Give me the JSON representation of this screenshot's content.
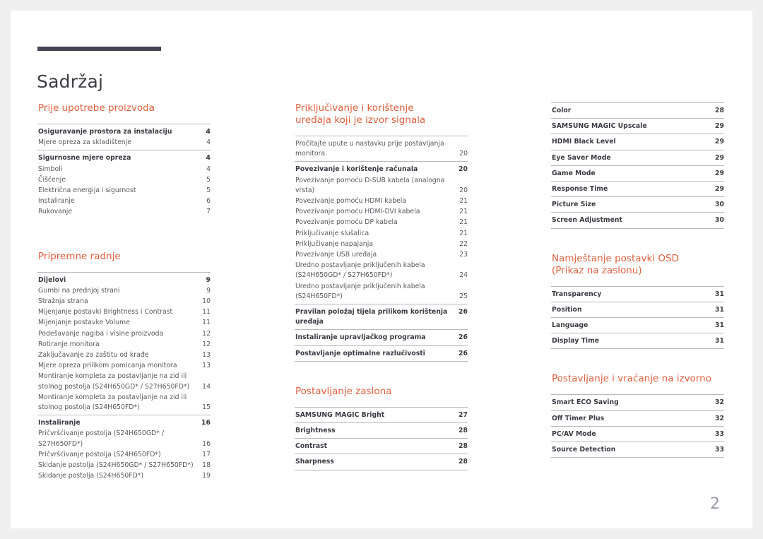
{
  "document": {
    "title": "Sadržaj",
    "page_number": "2",
    "accent_color": "#e0603f",
    "rule_color": "#464353",
    "text_color": "#58585f"
  },
  "columns": [
    {
      "name": "column-left",
      "sections": [
        {
          "heading": "Prije upotrebe proizvoda",
          "groups": [
            {
              "entries": [
                {
                  "label": "Osiguravanje prostora za instalaciju",
                  "page": "4",
                  "bold": true
                },
                {
                  "label": "Mjere opreza za skladištenje",
                  "page": "4",
                  "bold": false
                }
              ]
            },
            {
              "entries": [
                {
                  "label": "Sigurnosne mjere opreza",
                  "page": "4",
                  "bold": true
                },
                {
                  "label": "Simboli",
                  "page": "4",
                  "bold": false
                },
                {
                  "label": "Čišćenje",
                  "page": "5",
                  "bold": false
                },
                {
                  "label": "Električna energija i sigurnost",
                  "page": "5",
                  "bold": false
                },
                {
                  "label": "Instaliranje",
                  "page": "6",
                  "bold": false
                },
                {
                  "label": "Rukovanje",
                  "page": "7",
                  "bold": false
                }
              ]
            }
          ]
        },
        {
          "heading": "Pripremne radnje",
          "groups": [
            {
              "entries": [
                {
                  "label": "Dijelovi",
                  "page": "9",
                  "bold": true
                },
                {
                  "label": "Gumbi na prednjoj strani",
                  "page": "9",
                  "bold": false
                },
                {
                  "label": "Stražnja strana",
                  "page": "10",
                  "bold": false
                },
                {
                  "label": "Mijenjanje postavki Brightness i Contrast",
                  "page": "11",
                  "bold": false
                },
                {
                  "label": "Mijenjanje postavke Volume",
                  "page": "11",
                  "bold": false
                },
                {
                  "label": "Podešavanje nagiba i visine proizvoda",
                  "page": "12",
                  "bold": false
                },
                {
                  "label": "Rotiranje monitora",
                  "page": "12",
                  "bold": false
                },
                {
                  "label": "Zaključavanje za zaštitu od krađe",
                  "page": "13",
                  "bold": false
                },
                {
                  "label": "Mjere opreza prilikom pomicanja monitora",
                  "page": "13",
                  "bold": false
                },
                {
                  "label": "Montiranje kompleta za postavljanje na zid ili\nstolnog postolja (S24H650GD* / S27H650FD*)",
                  "page": "14",
                  "bold": false,
                  "two_line": true
                },
                {
                  "label": "Montiranje kompleta za postavljanje na zid ili\nstolnog postolja (S24H650FD*)",
                  "page": "15",
                  "bold": false,
                  "two_line": true
                }
              ]
            },
            {
              "entries": [
                {
                  "label": "Instaliranje",
                  "page": "16",
                  "bold": true
                },
                {
                  "label": "Pričvršćivanje postolja (S24H650GD* /\nS27H650FD*)",
                  "page": "16",
                  "bold": false,
                  "two_line": true
                },
                {
                  "label": "Pričvršćivanje postolja (S24H650FD*)",
                  "page": "17",
                  "bold": false
                },
                {
                  "label": "Skidanje postolja (S24H650GD* / S27H650FD*)",
                  "page": "18",
                  "bold": false
                },
                {
                  "label": "Skidanje postolja (S24H650FD*)",
                  "page": "19",
                  "bold": false
                }
              ]
            }
          ]
        }
      ]
    },
    {
      "name": "column-middle",
      "sections": [
        {
          "heading": "Priključivanje i korištenje\nuređaja koji je izvor signala",
          "groups": [
            {
              "entries": [
                {
                  "label": "Pročitajte upute u nastavku prije postavljanja\nmonitora.",
                  "page": "20",
                  "bold": false,
                  "two_line": true
                }
              ]
            },
            {
              "entries": [
                {
                  "label": "Povezivanje i korištenje računala",
                  "page": "20",
                  "bold": true
                },
                {
                  "label": "Povezivanje pomoću D-SUB kabela (analogna\nvrsta)",
                  "page": "20",
                  "bold": false,
                  "two_line": true
                },
                {
                  "label": "Povezivanje pomoću HDMI kabela",
                  "page": "21",
                  "bold": false
                },
                {
                  "label": "Povezivanje pomoću HDMI-DVI kabela",
                  "page": "21",
                  "bold": false
                },
                {
                  "label": "Povezivanje pomoću DP kabela",
                  "page": "21",
                  "bold": false
                },
                {
                  "label": "Priključivanje slušalica",
                  "page": "21",
                  "bold": false
                },
                {
                  "label": "Priključivanje napajanja",
                  "page": "22",
                  "bold": false
                },
                {
                  "label": "Povezivanje USB uređaja",
                  "page": "23",
                  "bold": false
                },
                {
                  "label": "Uredno postavljanje priključenih kabela\n(S24H650GD* / S27H650FD*)",
                  "page": "24",
                  "bold": false,
                  "two_line": true
                },
                {
                  "label": "Uredno postavljanje priključenih kabela\n(S24H650FD*)",
                  "page": "25",
                  "bold": false,
                  "two_line": true
                }
              ]
            },
            {
              "entries": [
                {
                  "label": "Pravilan položaj tijela prilikom korištenja uređaja",
                  "page": "26",
                  "bold": true
                }
              ]
            },
            {
              "entries": [
                {
                  "label": "Instaliranje upravljačkog programa",
                  "page": "26",
                  "bold": true
                }
              ]
            },
            {
              "entries": [
                {
                  "label": "Postavljanje optimalne razlučivosti",
                  "page": "26",
                  "bold": true
                }
              ],
              "last": true
            }
          ]
        },
        {
          "heading": "Postavljanje zaslona",
          "groups": [
            {
              "entries": [
                {
                  "label": "SAMSUNG MAGIC Bright",
                  "page": "27",
                  "bold": true
                }
              ]
            },
            {
              "entries": [
                {
                  "label": "Brightness",
                  "page": "28",
                  "bold": true
                }
              ]
            },
            {
              "entries": [
                {
                  "label": "Contrast",
                  "page": "28",
                  "bold": true
                }
              ]
            },
            {
              "entries": [
                {
                  "label": "Sharpness",
                  "page": "28",
                  "bold": true
                }
              ],
              "last": true
            }
          ]
        }
      ]
    },
    {
      "name": "column-right",
      "sections": [
        {
          "heading": "",
          "groups": [
            {
              "entries": [
                {
                  "label": "Color",
                  "page": "28",
                  "bold": true
                }
              ]
            },
            {
              "entries": [
                {
                  "label": "SAMSUNG MAGIC Upscale",
                  "page": "29",
                  "bold": true
                }
              ]
            },
            {
              "entries": [
                {
                  "label": "HDMI Black Level",
                  "page": "29",
                  "bold": true
                }
              ]
            },
            {
              "entries": [
                {
                  "label": "Eye Saver Mode",
                  "page": "29",
                  "bold": true
                }
              ]
            },
            {
              "entries": [
                {
                  "label": "Game Mode",
                  "page": "29",
                  "bold": true
                }
              ]
            },
            {
              "entries": [
                {
                  "label": "Response Time",
                  "page": "29",
                  "bold": true
                }
              ]
            },
            {
              "entries": [
                {
                  "label": "Picture Size",
                  "page": "30",
                  "bold": true
                }
              ]
            },
            {
              "entries": [
                {
                  "label": "Screen Adjustment",
                  "page": "30",
                  "bold": true
                }
              ],
              "last": true
            }
          ]
        },
        {
          "heading": "Namještanje postavki OSD\n(Prikaz na zaslonu)",
          "groups": [
            {
              "entries": [
                {
                  "label": "Transparency",
                  "page": "31",
                  "bold": true
                }
              ]
            },
            {
              "entries": [
                {
                  "label": "Position",
                  "page": "31",
                  "bold": true
                }
              ]
            },
            {
              "entries": [
                {
                  "label": "Language",
                  "page": "31",
                  "bold": true
                }
              ]
            },
            {
              "entries": [
                {
                  "label": "Display Time",
                  "page": "31",
                  "bold": true
                }
              ],
              "last": true
            }
          ]
        },
        {
          "heading": "Postavljanje i vraćanje na izvorno",
          "groups": [
            {
              "entries": [
                {
                  "label": "Smart ECO Saving",
                  "page": "32",
                  "bold": true
                }
              ]
            },
            {
              "entries": [
                {
                  "label": "Off Timer Plus",
                  "page": "32",
                  "bold": true
                }
              ]
            },
            {
              "entries": [
                {
                  "label": "PC/AV Mode",
                  "page": "33",
                  "bold": true
                }
              ]
            },
            {
              "entries": [
                {
                  "label": "Source Detection",
                  "page": "33",
                  "bold": true
                }
              ],
              "last": true
            }
          ]
        }
      ]
    }
  ]
}
